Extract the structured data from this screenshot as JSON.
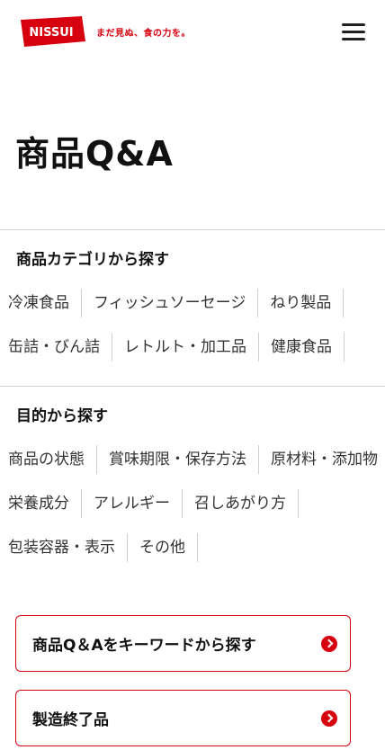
{
  "header": {
    "logo_text": "NISSUI",
    "tagline": "まだ見ぬ、食の力を。"
  },
  "page": {
    "title": "商品Q&A"
  },
  "category_section": {
    "heading": "商品カテゴリから探す",
    "rows": [
      [
        "冷凍食品",
        "フィッシュソーセージ",
        "ねり製品"
      ],
      [
        "缶詰・びん詰",
        "レトルト・加工品",
        "健康食品"
      ]
    ]
  },
  "purpose_section": {
    "heading": "目的から探す",
    "rows": [
      [
        "商品の状態",
        "賞味期限・保存方法",
        "原材料・添加物"
      ],
      [
        "栄養成分",
        "アレルギー",
        "召しあがり方"
      ],
      [
        "包装容器・表示",
        "その他"
      ]
    ]
  },
  "cta": {
    "keyword_search": "商品Q＆Aをキーワードから探す",
    "discontinued": "製造終了品"
  },
  "colors": {
    "brand_red": "#d7000f"
  }
}
